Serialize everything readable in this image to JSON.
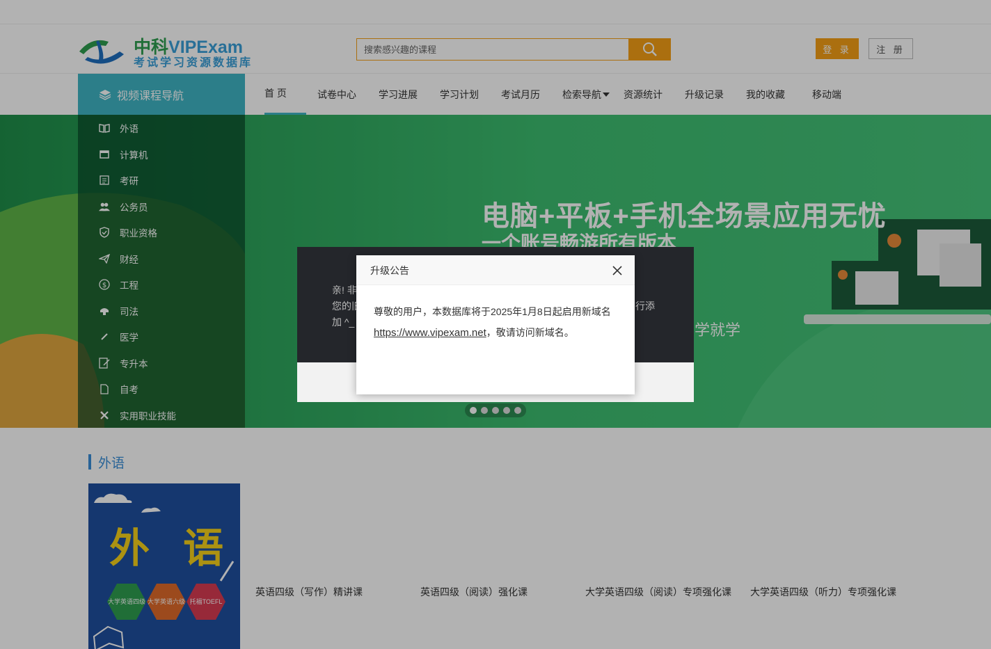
{
  "header": {
    "logo_brand_cn": "中科",
    "logo_brand_en": "VIPExam",
    "logo_tagline": "考试学习资源数据库",
    "search_placeholder": "搜索感兴趣的课程",
    "login_label": "登 录",
    "register_label": "注 册"
  },
  "nav": {
    "side_title": "视频课程导航",
    "items": [
      {
        "label": "首 页",
        "active": true
      },
      {
        "label": "试卷中心"
      },
      {
        "label": "学习进展"
      },
      {
        "label": "学习计划"
      },
      {
        "label": "考试月历"
      },
      {
        "label": "检索导航"
      },
      {
        "label": "资源统计"
      },
      {
        "label": "升级记录"
      },
      {
        "label": "我的收藏"
      },
      {
        "label": "移动端"
      }
    ]
  },
  "side_menu": {
    "items": [
      {
        "label": "外语",
        "icon": "book-icon"
      },
      {
        "label": "计算机",
        "icon": "monitor-icon"
      },
      {
        "label": "考研",
        "icon": "document-icon"
      },
      {
        "label": "公务员",
        "icon": "users-icon"
      },
      {
        "label": "职业资格",
        "icon": "shield-icon"
      },
      {
        "label": "财经",
        "icon": "paper-plane-icon"
      },
      {
        "label": "工程",
        "icon": "dollar-circle-icon"
      },
      {
        "label": "司法",
        "icon": "gavel-icon"
      },
      {
        "label": "医学",
        "icon": "pen-icon"
      },
      {
        "label": "专升本",
        "icon": "edit-document-icon"
      },
      {
        "label": "自考",
        "icon": "file-icon"
      },
      {
        "label": "实用职业技能",
        "icon": "tools-icon"
      }
    ]
  },
  "banner": {
    "title": "电脑+平板+手机全场景应用无忧",
    "subtitle": "一个账号畅游所有版本",
    "tagline": "学就学",
    "dots_count": 5,
    "active_dot": 0
  },
  "back_dialog": {
    "line1": "亲! 非",
    "line2": "您的旧",
    "line3": "加 ^_",
    "line2_tail": "行添"
  },
  "notice_dialog": {
    "title": "升级公告",
    "body_text": "尊敬的用户，本数据库将于2025年1月8日起启用新域名",
    "link": "https://www.vipexam.net",
    "body_tail": "，敬请访问新域名。"
  },
  "section": {
    "title": "外语",
    "cover_text": "外 语",
    "badges": [
      "大学英语四级",
      "大学英语六级",
      "托福TOEFL"
    ],
    "courses": [
      "英语四级（写作）精讲课",
      "英语四级（阅读）强化课",
      "大学英语四级（阅读）专项强化课",
      "大学英语四级（听力）专项强化课"
    ]
  },
  "colors": {
    "accent_orange": "#f5a016",
    "nav_teal": "#3fb5c4",
    "section_blue": "#3a8fd8",
    "banner_green": "#3dbe70"
  }
}
